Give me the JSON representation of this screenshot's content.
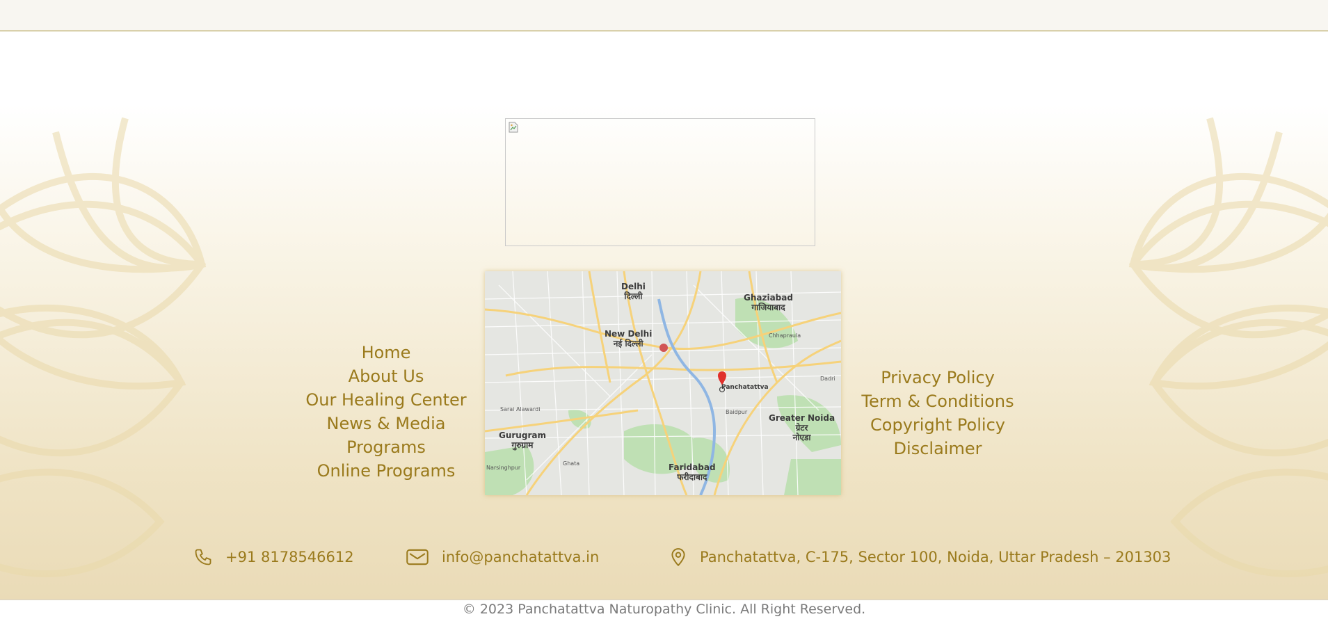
{
  "logo": {
    "alt": ""
  },
  "map": {
    "labels": [
      {
        "text": "Delhi\nदिल्ली"
      },
      {
        "text": "Ghaziabad\nगाजियाबाद"
      },
      {
        "text": "New Delhi\nनई दिल्ली"
      },
      {
        "text": "Panchatattva"
      },
      {
        "text": "Greater Noida\nग्रेटर\nनोएडा"
      },
      {
        "text": "Gurugram\nगुरुग्राम"
      },
      {
        "text": "Faridabad\nफरीदाबाद"
      },
      {
        "text": "Sarai Alawardi"
      },
      {
        "text": "Narsinghpur"
      },
      {
        "text": "Ghata"
      },
      {
        "text": "Chhapraula"
      },
      {
        "text": "Dadri"
      },
      {
        "text": "Baidpur"
      }
    ]
  },
  "nav_left": [
    "Home",
    "About Us",
    "Our Healing Center",
    "News & Media",
    "Programs",
    "Online Programs"
  ],
  "nav_right": [
    "Privacy Policy",
    "Term & Conditions",
    "Copyright Policy",
    "Disclaimer"
  ],
  "contact": {
    "phone": "+91 8178546612",
    "email": "info@panchatattva.in",
    "address": "Panchatattva, C-175, Sector 100, Noida, Uttar Pradesh – 201303"
  },
  "copyright": "© 2023 Panchatattva Naturopathy Clinic. All Right Reserved.",
  "colors": {
    "accent": "#9a7a1c",
    "topbar_border": "#a08a2c"
  }
}
